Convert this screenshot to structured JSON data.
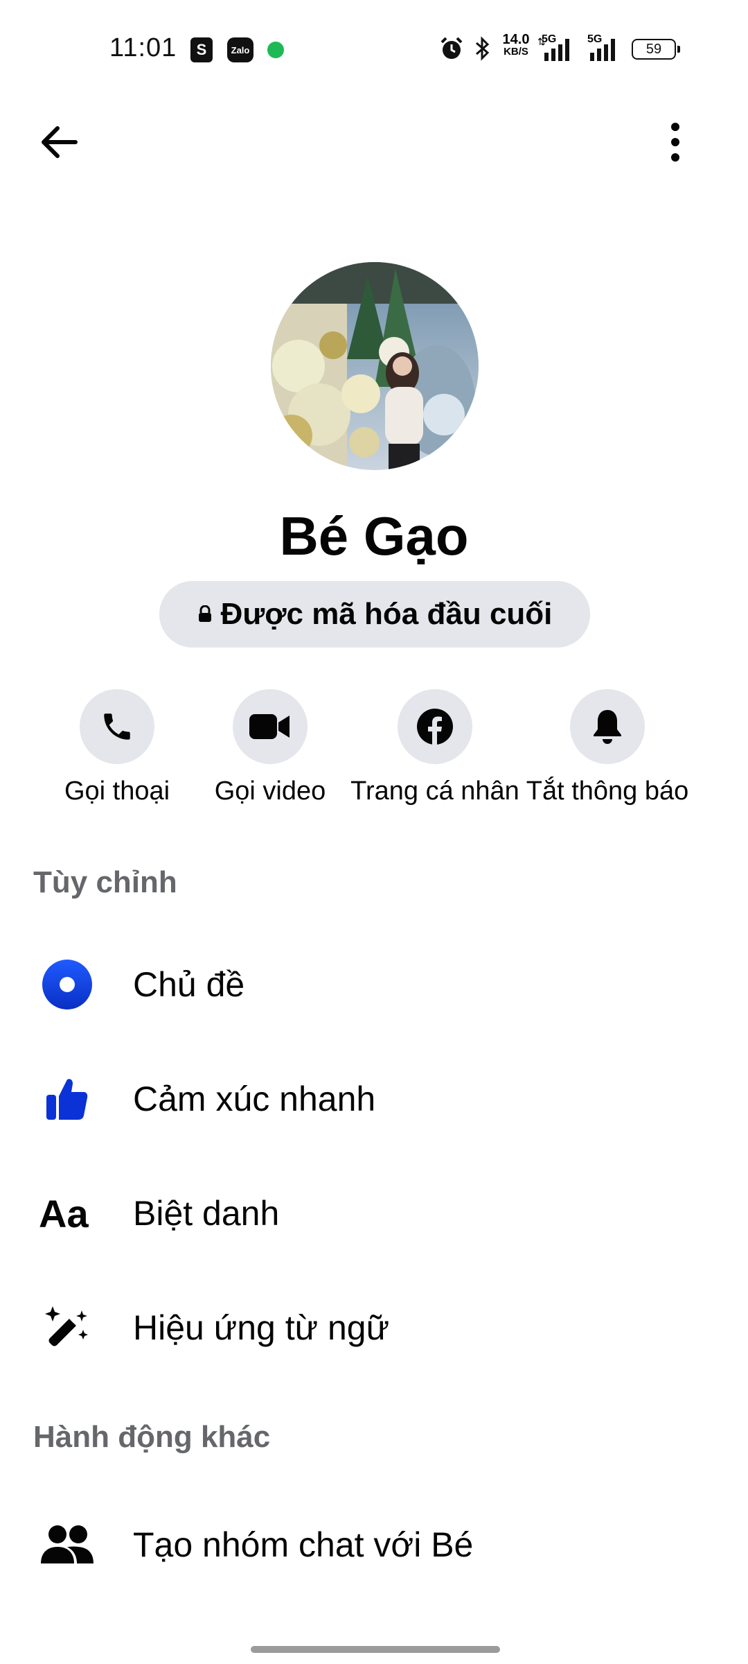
{
  "status_bar": {
    "time": "11:01",
    "net_speed_top": "14.0",
    "net_speed_bottom": "KB/S",
    "sim1": "5G",
    "sim2": "5G",
    "battery": "59",
    "notif_zalo": "Zalo"
  },
  "profile": {
    "name": "Bé Gạo",
    "encryption_label": "Được mã hóa đầu cuối"
  },
  "actions": [
    {
      "label": "Gọi thoại",
      "icon": "phone-icon"
    },
    {
      "label": "Gọi video",
      "icon": "video-camera-icon"
    },
    {
      "label": "Trang cá nhân",
      "icon": "facebook-icon"
    },
    {
      "label": "Tắt thông báo",
      "icon": "bell-icon"
    }
  ],
  "sections": {
    "customize": {
      "title": "Tùy chỉnh",
      "items": [
        {
          "label": "Chủ đề",
          "icon": "theme-icon"
        },
        {
          "label": "Cảm xúc nhanh",
          "icon": "thumbs-up-icon"
        },
        {
          "label": "Biệt danh",
          "icon": "text-aa-icon"
        },
        {
          "label": "Hiệu ứng từ ngữ",
          "icon": "magic-wand-icon"
        }
      ]
    },
    "other_actions": {
      "title": "Hành động khác",
      "items": [
        {
          "label": "Tạo nhóm chat với Bé",
          "icon": "people-icon"
        }
      ]
    }
  },
  "colors": {
    "accent_blue": "#0a3ee0",
    "pill_gray": "#e4e6eb",
    "secondary_text": "#65676b"
  }
}
